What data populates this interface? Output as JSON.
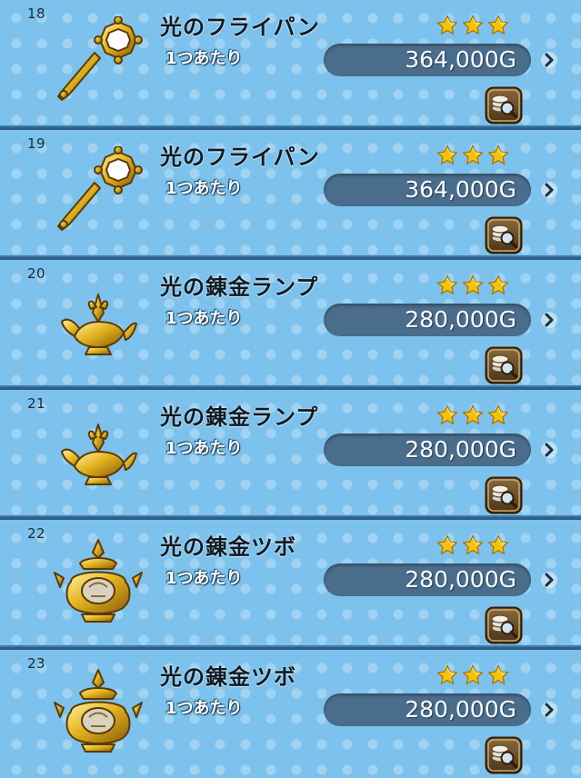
{
  "items": [
    {
      "number": "18",
      "name": "光のフライパン",
      "per_unit": "1つあたり",
      "price": "364,000G",
      "stars": 3,
      "icon": "frying-pan-icon"
    },
    {
      "number": "19",
      "name": "光のフライパン",
      "per_unit": "1つあたり",
      "price": "364,000G",
      "stars": 3,
      "icon": "frying-pan-icon"
    },
    {
      "number": "20",
      "name": "光の錬金ランプ",
      "per_unit": "1つあたり",
      "price": "280,000G",
      "stars": 3,
      "icon": "lamp-icon"
    },
    {
      "number": "21",
      "name": "光の錬金ランプ",
      "per_unit": "1つあたり",
      "price": "280,000G",
      "stars": 3,
      "icon": "lamp-icon"
    },
    {
      "number": "22",
      "name": "光の錬金ツボ",
      "per_unit": "1つあたり",
      "price": "280,000G",
      "stars": 3,
      "icon": "pot-icon"
    },
    {
      "number": "23",
      "name": "光の錬金ツボ",
      "per_unit": "1つあたり",
      "price": "280,000G",
      "stars": 3,
      "icon": "pot-icon"
    }
  ],
  "colors": {
    "row_background": "#7cc2ec",
    "price_pill": "#4b6d8c",
    "star": "#f5c20a",
    "gold": "#e3b420"
  }
}
